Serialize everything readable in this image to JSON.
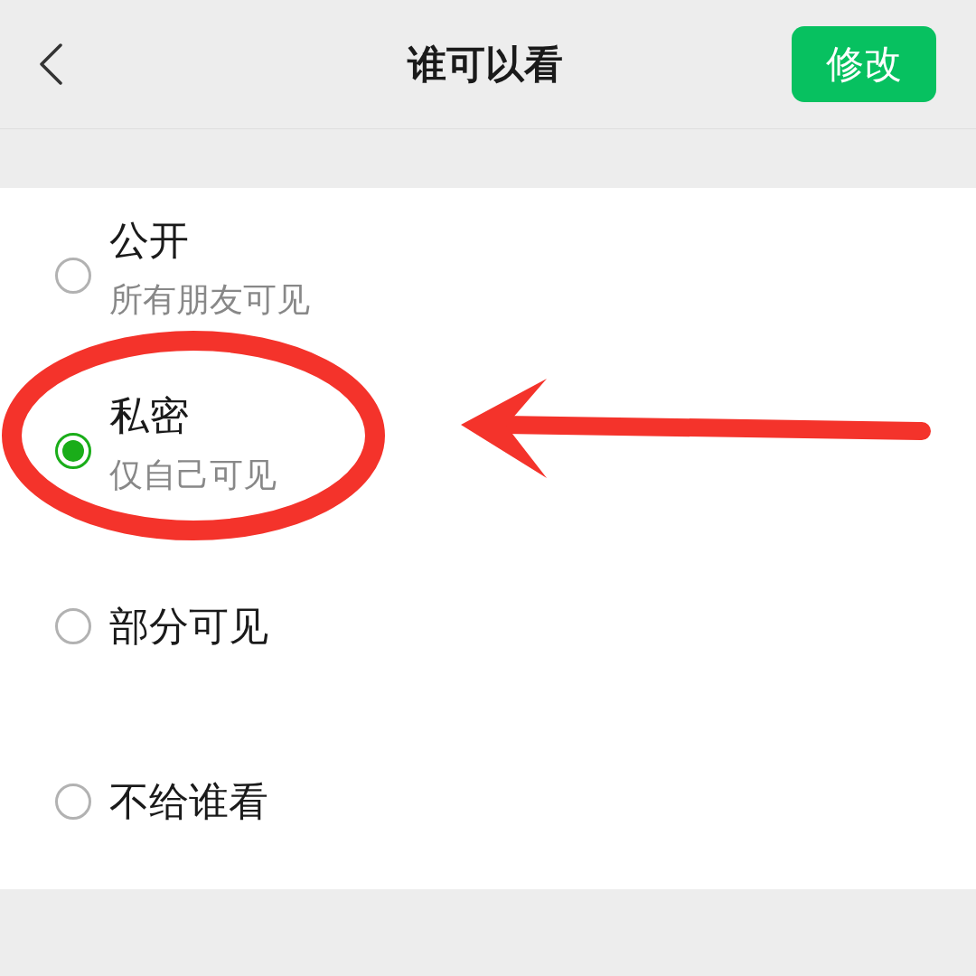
{
  "header": {
    "title": "谁可以看",
    "action_button": "修改"
  },
  "options": [
    {
      "title": "公开",
      "subtitle": "所有朋友可见",
      "selected": false,
      "circled": false,
      "arrow": false
    },
    {
      "title": "私密",
      "subtitle": "仅自己可见",
      "selected": true,
      "circled": true,
      "arrow": true
    },
    {
      "title": "部分可见",
      "selected": false,
      "circled": false,
      "arrow": false
    },
    {
      "title": "不给谁看",
      "selected": false,
      "circled": false,
      "arrow": false
    }
  ]
}
